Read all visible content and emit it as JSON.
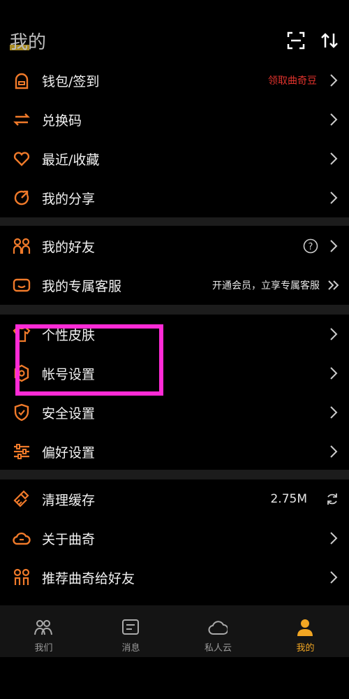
{
  "header": {
    "title": "我的"
  },
  "colors": {
    "accent": "#f07a2a",
    "tab_active": "#f2a623",
    "highlight": "#ff2bd6",
    "promo_red": "#e0322c"
  },
  "section1": [
    {
      "label": "钱包/签到",
      "right": "领取曲奇豆",
      "icon": "wallet-icon"
    },
    {
      "label": "兑换码",
      "icon": "exchange-icon"
    },
    {
      "label": "最近/收藏",
      "icon": "heart-icon"
    },
    {
      "label": "我的分享",
      "icon": "share-icon"
    }
  ],
  "section2": [
    {
      "label": "我的好友",
      "icon": "friends-icon"
    },
    {
      "label": "我的专属客服",
      "right": "开通会员，立享专属客服",
      "icon": "customer-service-icon"
    }
  ],
  "section3": [
    {
      "label": "个性皮肤",
      "icon": "shirt-icon"
    },
    {
      "label": "帐号设置",
      "icon": "gear-icon"
    },
    {
      "label": "安全设置",
      "icon": "shield-icon"
    },
    {
      "label": "偏好设置",
      "icon": "sliders-icon"
    }
  ],
  "section4": [
    {
      "label": "清理缓存",
      "right": "2.75M",
      "icon": "broom-icon"
    },
    {
      "label": "关于曲奇",
      "icon": "cloud-icon"
    },
    {
      "label": "推荐曲奇给好友",
      "icon": "recommend-icon"
    }
  ],
  "tabs": [
    {
      "label": "我们",
      "icon": "people-icon"
    },
    {
      "label": "消息",
      "icon": "message-icon"
    },
    {
      "label": "私人云",
      "icon": "cloud-icon"
    },
    {
      "label": "我的",
      "icon": "profile-icon",
      "active": true
    }
  ]
}
